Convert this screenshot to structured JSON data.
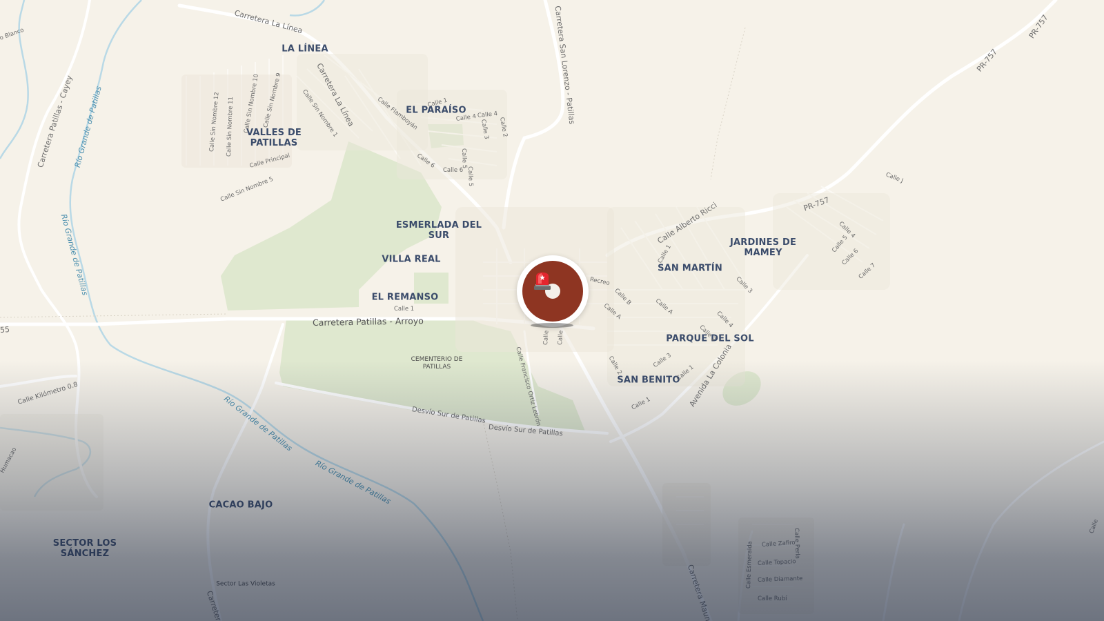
{
  "map": {
    "place_labels": [
      {
        "id": "la-linea",
        "text": "LA LÍNEA"
      },
      {
        "id": "el-paraiso",
        "text": "EL PARAÍSO"
      },
      {
        "id": "valles-de-patillas",
        "lines": [
          "VALLES DE",
          "PATILLAS"
        ]
      },
      {
        "id": "esmerlada-del-sur",
        "lines": [
          "ESMERLADA DEL",
          "SUR"
        ]
      },
      {
        "id": "villa-real",
        "text": "VILLA REAL"
      },
      {
        "id": "el-remanso",
        "text": "EL REMANSO"
      },
      {
        "id": "jardines-de-mamey",
        "lines": [
          "JARDINES DE",
          "MAMEY"
        ]
      },
      {
        "id": "san-martin",
        "text": "SAN MARTÍN"
      },
      {
        "id": "parque-del-sol",
        "text": "PARQUE DEL SOL"
      },
      {
        "id": "san-benito",
        "text": "SAN BENITO"
      },
      {
        "id": "cacao-bajo",
        "text": "CACAO BAJO"
      },
      {
        "id": "sector-los-sanchez",
        "lines": [
          "SECTOR LOS",
          "SÁNCHEZ"
        ]
      }
    ],
    "poi_labels": [
      {
        "id": "cementerio",
        "lines": [
          "CEMENTERIO DE",
          "PATILLAS"
        ]
      },
      {
        "id": "sector-las-violetas",
        "text": "Sector Las Violetas"
      }
    ],
    "road_labels": [
      "Carretera La Línea",
      "Carretera San Lorenzo - Patillas",
      "Carretera Patillas - Cayey",
      "Carretera La Línea",
      "Carretera Patillas - Arroyo",
      "PR-757",
      "PR-757",
      "PR-757",
      "Calle Alberto Ricci",
      "Avenida La Colonia",
      "Desvío Sur de Patillas",
      "Desvío Sur de Patillas",
      "Calle Kilómetro 0.8",
      "Carretera Maunabo",
      "Carretera",
      "55",
      "o Blanco"
    ],
    "street_labels": [
      "Calle Sin Nombre 12",
      "Calle Sin Nombre 11",
      "Calle Sin Nombre 10",
      "Calle Sin Nombre 9",
      "Calle Sin Nombre 1",
      "Calle Principal",
      "Calle Sin Nombre 5",
      "Calle Flamboyán",
      "Calle 1",
      "Calle 4",
      "Calle 4",
      "Calle 3",
      "Calle 2",
      "Calle 6",
      "Calle 6",
      "Calle 5",
      "Calle 5",
      "Calle 1",
      "Calle Francisco Ortiz Lebrón",
      "Recreo",
      "Calle B",
      "Calle A",
      "Calle A",
      "Calle 1",
      "Calle 3",
      "Calle 4",
      "Calle 2",
      "Calle 2",
      "Calle 3",
      "Calle 1",
      "Calle 1",
      "Calle J",
      "Calle 4",
      "Calle 5",
      "Calle 6",
      "Calle 7",
      "Calle Zafiro",
      "Calle Topacio",
      "Calle Diamante",
      "Calle Rubí",
      "Calle Esmeralda",
      "Calle Perla",
      "Calle",
      "Calle",
      "Calle",
      "Humacao"
    ],
    "river_labels": [
      "Río Grande de Patillas",
      "Río Grande de Patillas",
      "Río Grande de Patillas",
      "Río Grande de Patillas"
    ]
  },
  "marker": {
    "icon": "siren-icon",
    "color": "#8e3522"
  }
}
